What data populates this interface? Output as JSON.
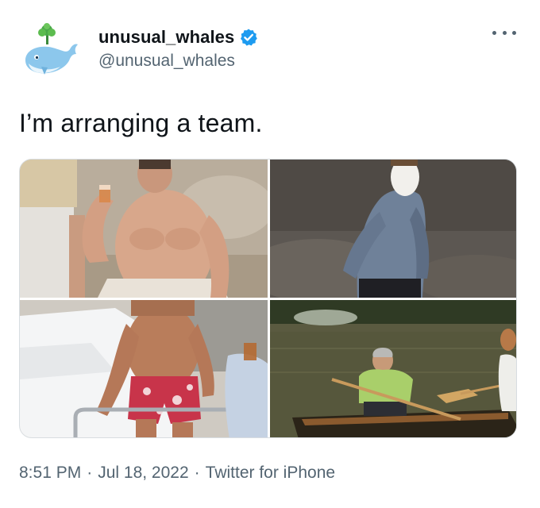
{
  "author": {
    "display_name": "unusual_whales",
    "handle": "@unusual_whales",
    "verified": true,
    "avatar_icon": "whale-logo-icon"
  },
  "tweet": {
    "text": "I’m arranging a team."
  },
  "media": {
    "count": 4
  },
  "meta": {
    "time": "8:51 PM",
    "separator": "·",
    "date": "Jul 18, 2022",
    "source": "Twitter for iPhone"
  },
  "colors": {
    "text_primary": "#0f1419",
    "text_secondary": "#536471",
    "verified_blue": "#1d9bf0",
    "whale_blue": "#8cc7ec",
    "spout_green": "#4aa84a"
  }
}
